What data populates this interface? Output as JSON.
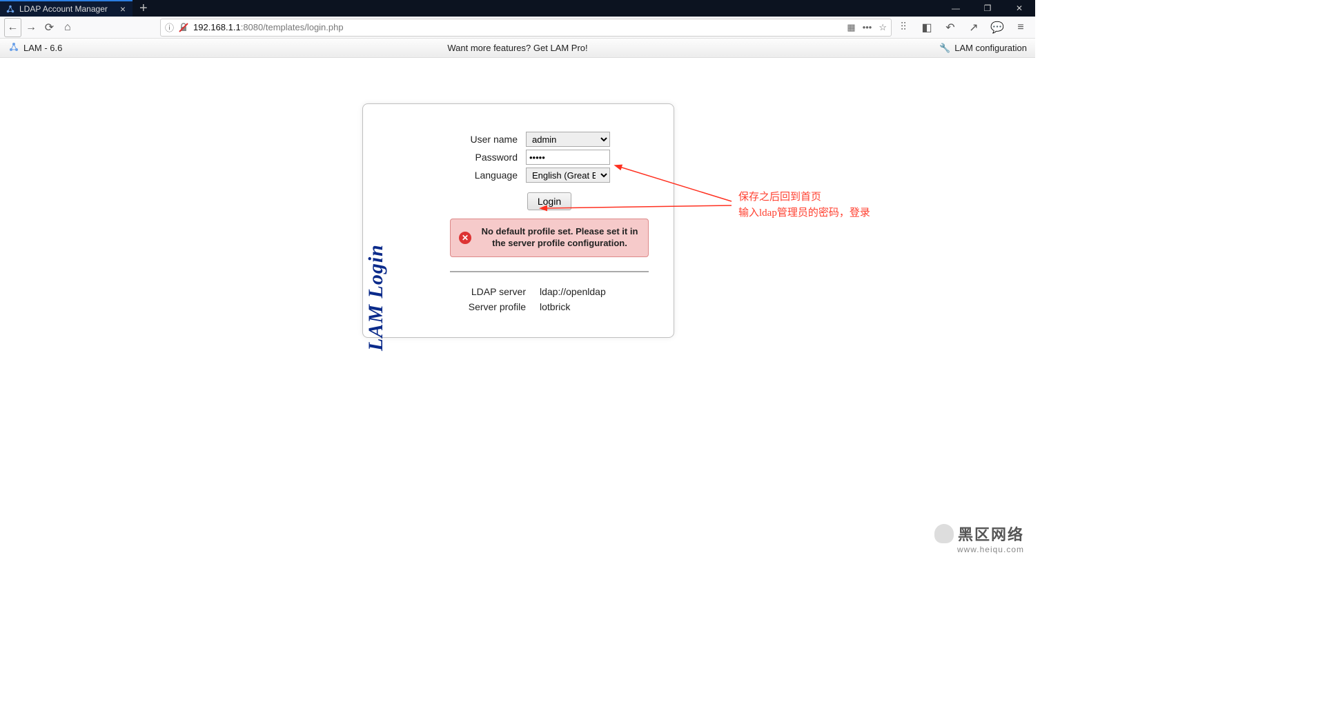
{
  "browser": {
    "tab_title": "LDAP Account Manager",
    "url_prefix": "192.168.1.1",
    "url_suffix": ":8080/templates/login.php"
  },
  "app_header": {
    "brand": "LAM - 6.6",
    "center": "Want more features? Get LAM Pro!",
    "config": "LAM configuration"
  },
  "login": {
    "side_logo": "LAM  Login",
    "labels": {
      "username": "User name",
      "password": "Password",
      "language": "Language"
    },
    "values": {
      "username": "admin",
      "password": "•••••",
      "language": "English (Great Britain)"
    },
    "button": "Login",
    "error": "No default profile set. Please set it in the server profile configuration.",
    "server": {
      "label": "LDAP server",
      "value": "ldap://openldap"
    },
    "profile": {
      "label": "Server profile",
      "value": "lotbrick"
    }
  },
  "annotation": {
    "line1": "保存之后回到首页",
    "line2": "输入ldap管理员的密码，登录"
  },
  "watermark": {
    "title": "黑区网络",
    "sub": "www.heiqu.com"
  }
}
